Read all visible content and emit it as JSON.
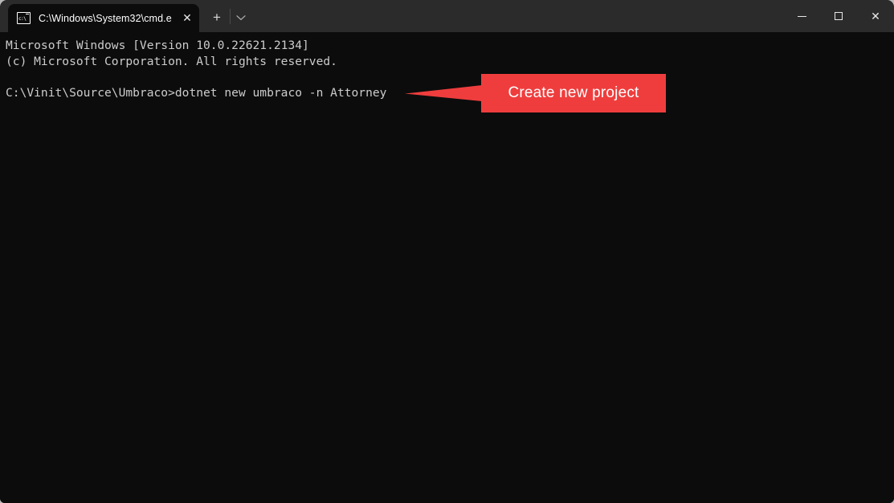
{
  "window": {
    "titlebar": {
      "tab": {
        "icon": "cmd-console-icon",
        "title": "C:\\Windows\\System32\\cmd.e",
        "close_label": "✕"
      },
      "new_tab_label": "+",
      "tab_menu_icon": "chevron-down-icon",
      "controls": {
        "minimize_label": "─",
        "maximize_label": "□",
        "close_label": "✕"
      }
    },
    "terminal": {
      "lines": [
        "Microsoft Windows [Version 10.0.22621.2134]",
        "(c) Microsoft Corporation. All rights reserved.",
        "",
        "C:\\Vinit\\Source\\Umbraco>dotnet new umbraco -n Attorney"
      ],
      "prompt_path": "C:\\Vinit\\Source\\Umbraco>",
      "command": "dotnet new umbraco -n Attorney"
    },
    "annotation": {
      "label": "Create new project",
      "color": "#ef3d3d",
      "text_color": "#ffffff",
      "arrow_direction": "left"
    },
    "colors": {
      "titlebar_bg": "#2b2b2b",
      "terminal_bg": "#0c0c0c",
      "terminal_text": "#cccccc",
      "desktop_bg": "#b9b9b9"
    }
  }
}
